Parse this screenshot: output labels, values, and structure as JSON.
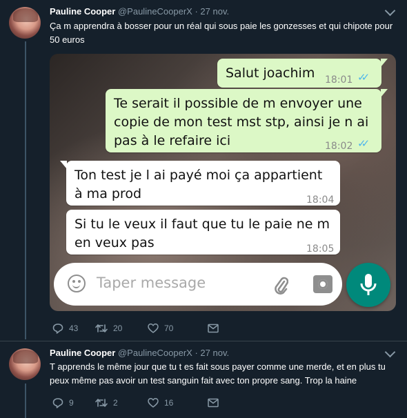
{
  "tweets": [
    {
      "name": "Pauline Cooper",
      "handle": "@PaulineCooperX",
      "date": "· 27 nov.",
      "text": "Ça m apprendra à bosser pour un réal qui sous paie les gonzesses et qui chipote pour 50 euros",
      "replies": "43",
      "retweets": "20",
      "likes": "70"
    },
    {
      "name": "Pauline Cooper",
      "handle": "@PaulineCooperX",
      "date": "· 27 nov.",
      "text": "T apprends le même jour que tu t es fait sous payer comme une merde, et en plus tu peux même pas avoir un test sanguin fait avec ton propre sang.  Trop la haine",
      "replies": "9",
      "retweets": "2",
      "likes": "16"
    }
  ],
  "chat": {
    "messages": [
      {
        "text": "Salut joachim",
        "time": "18:01",
        "direction": "out"
      },
      {
        "text": "Te serait il possible de m envoyer une copie de mon test mst stp, ainsi je n ai pas à le refaire ici",
        "time": "18:02",
        "direction": "out"
      },
      {
        "text": "Ton test je l ai payé moi ça appartient à ma prod",
        "time": "18:04",
        "direction": "in"
      },
      {
        "text": "Si tu le veux il faut que tu le paie ne m en veux pas",
        "time": "18:05",
        "direction": "in"
      }
    ],
    "input_placeholder": "Taper message",
    "icons": {
      "emoji": "emoji-icon",
      "attach": "paperclip-icon",
      "camera": "camera-icon",
      "mic": "microphone-icon"
    },
    "colors": {
      "outgoing": "#dcf8c6",
      "incoming": "#ffffff",
      "read_ticks": "#4fb6ec",
      "mic_button": "#00897b"
    }
  },
  "theme": {
    "background": "#15202b",
    "muted": "#8899a6",
    "thread_line": "#3d5466"
  }
}
